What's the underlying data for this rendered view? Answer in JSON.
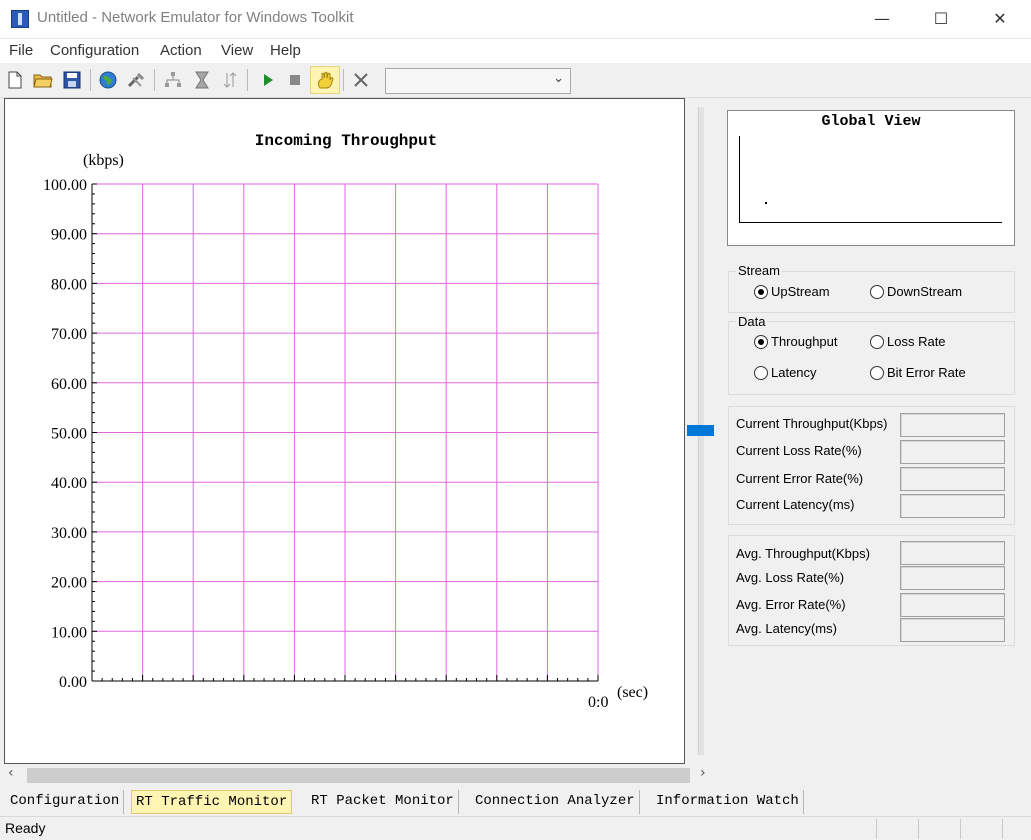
{
  "window": {
    "title": "Untitled - Network Emulator for Windows Toolkit"
  },
  "menu": [
    "File",
    "Configuration",
    "Action",
    "View",
    "Help"
  ],
  "toolbar": {
    "profile_select_value": ""
  },
  "graph": {
    "title": "Incoming Throughput",
    "y_unit": "(kbps)",
    "x_unit": "(sec)",
    "x_tick_label": "0:0"
  },
  "chart_data": {
    "type": "line",
    "title": "Incoming Throughput",
    "ylabel": "(kbps)",
    "xlabel": "(sec)",
    "ylim": [
      0,
      100
    ],
    "y_ticks": [
      "0.00",
      "10.00",
      "20.00",
      "30.00",
      "40.00",
      "50.00",
      "60.00",
      "70.00",
      "80.00",
      "90.00",
      "100.00"
    ],
    "x_ticks": [
      "0:0"
    ],
    "grid": true,
    "grid_color": "#e066e0",
    "x_grid_lines": 10,
    "series": []
  },
  "global_view": {
    "title": "Global View"
  },
  "stream": {
    "label": "Stream",
    "options": [
      {
        "label": "UpStream",
        "selected": true
      },
      {
        "label": "DownStream",
        "selected": false
      }
    ]
  },
  "data_group": {
    "label": "Data",
    "options": [
      {
        "label": "Throughput",
        "selected": true
      },
      {
        "label": "Loss Rate",
        "selected": false
      },
      {
        "label": "Latency",
        "selected": false
      },
      {
        "label": "Bit Error Rate",
        "selected": false
      }
    ]
  },
  "current_stats": [
    {
      "label": "Current Throughput(Kbps)",
      "value": ""
    },
    {
      "label": "Current Loss Rate(%)",
      "value": ""
    },
    {
      "label": "Current Error Rate(%)",
      "value": ""
    },
    {
      "label": "Current Latency(ms)",
      "value": ""
    }
  ],
  "avg_stats": [
    {
      "label": "Avg. Throughput(Kbps)",
      "value": ""
    },
    {
      "label": "Avg. Loss Rate(%)",
      "value": ""
    },
    {
      "label": "Avg. Error Rate(%)",
      "value": ""
    },
    {
      "label": "Avg. Latency(ms)",
      "value": ""
    }
  ],
  "tabs": [
    {
      "label": "Configuration",
      "active": false
    },
    {
      "label": "RT Traffic Monitor",
      "active": true
    },
    {
      "label": "RT Packet Monitor",
      "active": false
    },
    {
      "label": "Connection Analyzer",
      "active": false
    },
    {
      "label": "Information Watch",
      "active": false
    }
  ],
  "status": {
    "text": "Ready"
  },
  "colors": {
    "accent": "#0078d7",
    "active_tab": "#fff5b3",
    "grid": "#e066e0"
  }
}
